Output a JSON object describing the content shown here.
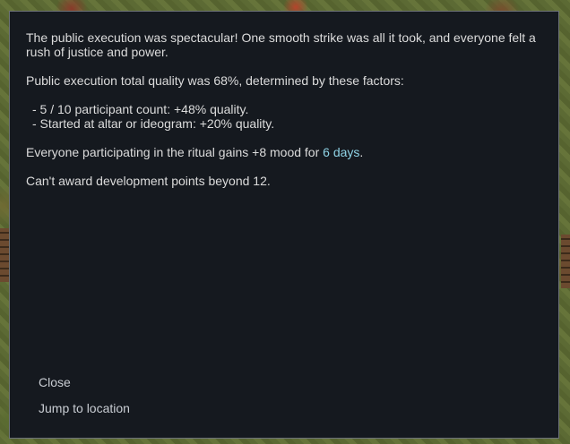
{
  "dialog": {
    "intro": "The public execution was spectacular! One smooth strike was all it took, and everyone felt a rush of justice and power.",
    "quality_summary": "Public execution total quality was 68%, determined by these factors:",
    "factors": [
      "- 5 / 10 participant count: +48% quality.",
      "- Started at altar or ideogram: +20% quality."
    ],
    "mood_prefix": "Everyone participating in the ritual gains +8 mood for ",
    "mood_duration": "6 days",
    "mood_suffix": ".",
    "development_note": "Can't award development points beyond 12."
  },
  "actions": {
    "close_label": "Close",
    "jump_label": "Jump to location"
  },
  "colors": {
    "dialog_background": "#15191f",
    "dialog_border": "#6d7279",
    "text": "#dcdcdc",
    "highlight": "#8fd3e6"
  }
}
